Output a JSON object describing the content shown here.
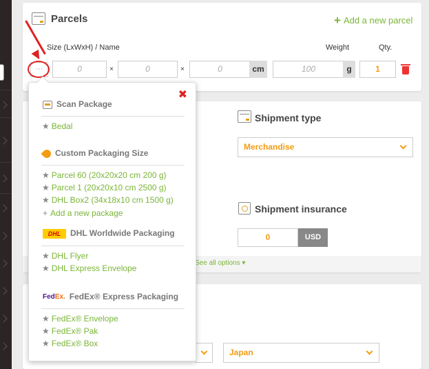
{
  "parcels": {
    "title": "Parcels",
    "add_label": "Add a new parcel",
    "size_label": "Size (LxWxH) / Name",
    "weight_label": "Weight",
    "qty_label": "Qty.",
    "dots_label": "···",
    "length_placeholder": "0",
    "width_placeholder": "0",
    "height_placeholder": "0",
    "dim_unit": "cm",
    "weight_placeholder": "100",
    "weight_unit": "g",
    "qty_value": "1",
    "times": "×"
  },
  "shipment_type": {
    "title": "Shipment type",
    "selected": "Merchandise"
  },
  "shipment_insurance": {
    "title": "Shipment insurance",
    "amount": "0",
    "currency": "USD"
  },
  "see_all_label": "See all options ▾",
  "country_select": "Japan",
  "popup": {
    "close_label": "✖",
    "scan_title": "Scan Package",
    "scan_items": [
      "Bedal"
    ],
    "custom_title": "Custom Packaging Size",
    "custom_items": [
      "Parcel 60 (20x20x20 cm 200 g)",
      "Parcel 1 (20x20x10 cm 2500 g)",
      "DHL Box2 (34x18x10 cm 1500 g)"
    ],
    "add_package_label": "Add a new package",
    "dhl_logo_text": "DHL",
    "dhl_title": "DHL Worldwide Packaging",
    "dhl_items": [
      "DHL Flyer",
      "DHL Express Envelope"
    ],
    "fedex_logo_fed": "Fed",
    "fedex_logo_ex": "Ex.",
    "fedex_title": "FedEx® Express Packaging",
    "fedex_items": [
      "FedEx® Envelope",
      "FedEx® Pak",
      "FedEx® Box"
    ]
  },
  "colors": {
    "accent_green": "#7ab536",
    "accent_orange": "#f39c12",
    "annotation_red": "#e02020"
  }
}
